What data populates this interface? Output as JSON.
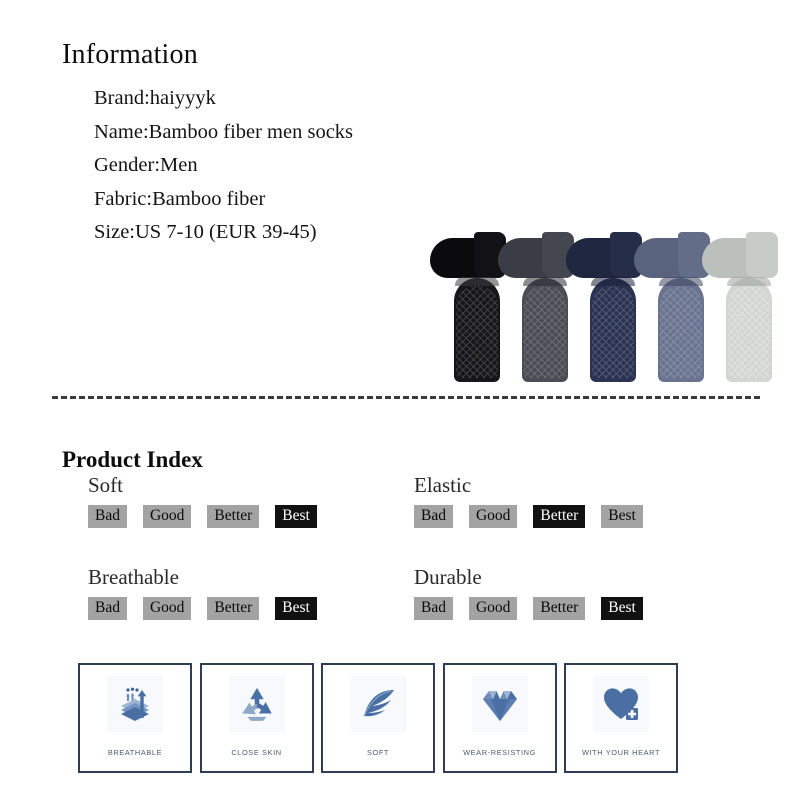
{
  "page": {
    "background": "#ffffff",
    "divider_color": "#3a3a3a"
  },
  "information": {
    "heading": "Information",
    "lines": [
      "Brand:haiyyyk",
      "Name:Bamboo fiber men socks",
      "Gender:Men",
      "Fabric:Bamboo fiber",
      "Size:US 7-10 (EUR 39-45)"
    ]
  },
  "product_photo": {
    "alt": "five bamboo fiber crew socks in a row",
    "socks": [
      {
        "name": "black-sock",
        "color": "#17171a",
        "shade": "#0b0b0d"
      },
      {
        "name": "dark-gray-sock",
        "color": "#4a4d55",
        "shade": "#3a3d45"
      },
      {
        "name": "navy-sock",
        "color": "#2b3352",
        "shade": "#1f2640"
      },
      {
        "name": "blue-gray-sock",
        "color": "#6a7490",
        "shade": "#59637e"
      },
      {
        "name": "light-gray-sock",
        "color": "#d2d5d2",
        "shade": "#bcc0bd"
      }
    ]
  },
  "product_index": {
    "heading": "Product Index",
    "scale": [
      "Bad",
      "Good",
      "Better",
      "Best"
    ],
    "active_color": "#111111",
    "inactive_color": "#a3a3a3",
    "items": [
      {
        "title": "Soft",
        "rating": "Best",
        "active_index": 3
      },
      {
        "title": "Elastic",
        "rating": "Better",
        "active_index": 2
      },
      {
        "title": "Breathable",
        "rating": "Best",
        "active_index": 3
      },
      {
        "title": "Durable",
        "rating": "Best",
        "active_index": 3
      }
    ]
  },
  "features": {
    "border_color": "#2e3d54",
    "icon_color": "#4a6fa5",
    "icon_color_light": "#8fa8c8",
    "cards": [
      {
        "label": "BREATHABLE",
        "icon": "breathable-layers-icon"
      },
      {
        "label": "CLOSE SKIN",
        "icon": "recycle-icon"
      },
      {
        "label": "SOFT",
        "icon": "feather-icon"
      },
      {
        "label": "WEAR-RESISTING",
        "icon": "diamond-icon"
      },
      {
        "label": "WITH YOUR HEART",
        "icon": "heart-plus-icon"
      }
    ]
  }
}
